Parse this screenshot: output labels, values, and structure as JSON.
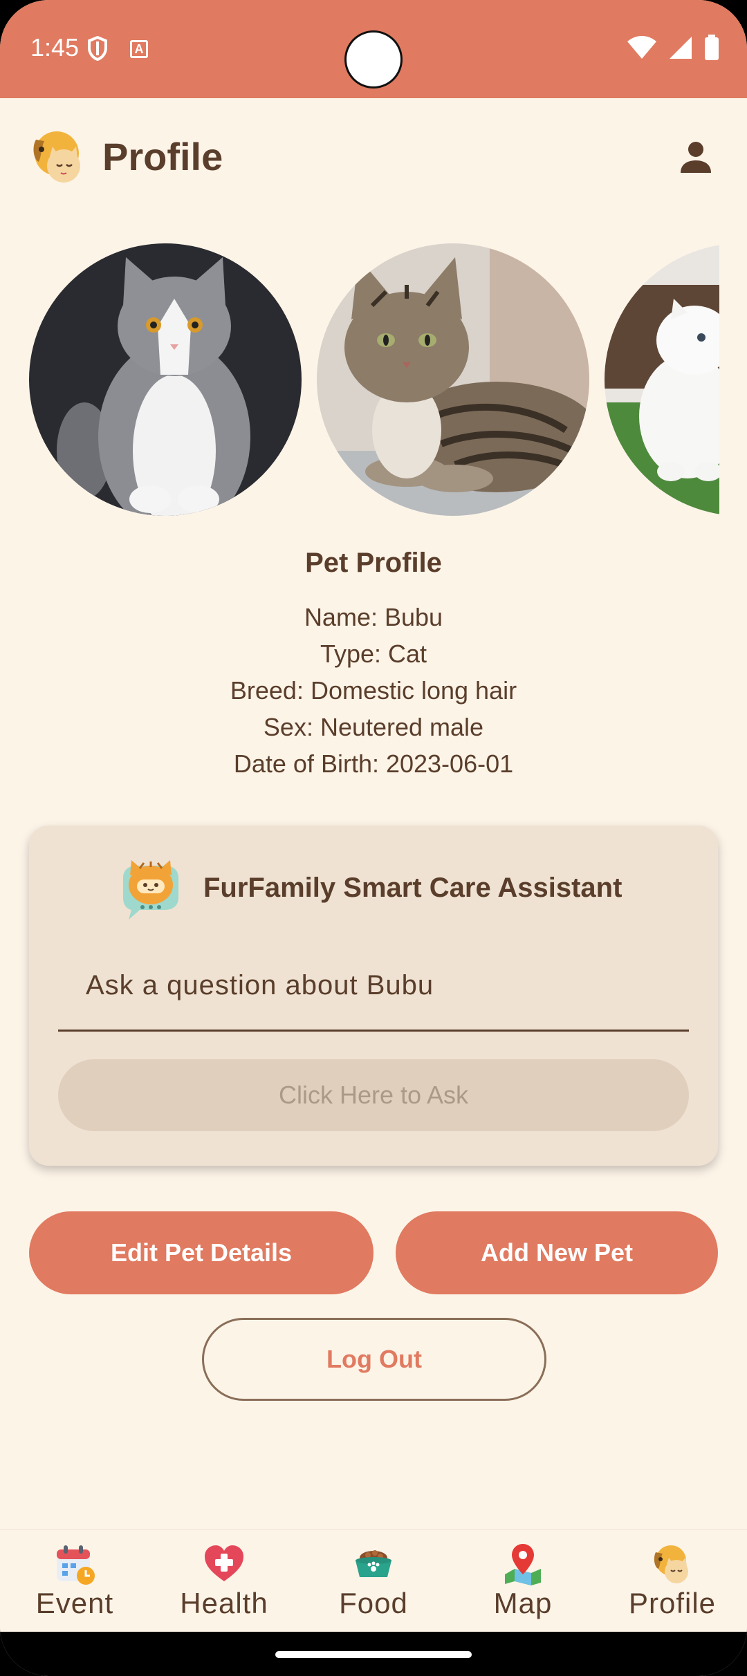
{
  "status_bar": {
    "time": "1:45",
    "a_glyph": "A"
  },
  "app_bar": {
    "title": "Profile",
    "logo_icon": "dog-cat-logo-icon",
    "account_icon": "person-icon"
  },
  "carousel": {
    "photos": [
      "grey-white-cat-photo",
      "tabby-cat-photo",
      "white-persian-cat-photo"
    ]
  },
  "pet_profile": {
    "heading": "Pet Profile",
    "name": "Name: Bubu",
    "type": "Type: Cat",
    "breed": "Breed: Domestic long hair",
    "sex": "Sex: Neutered male",
    "dob": "Date of Birth: 2023-06-01"
  },
  "assistant": {
    "title": "FurFamily Smart Care Assistant",
    "placeholder": "Ask a question about Bubu",
    "ask_button": "Click Here to Ask"
  },
  "actions": {
    "edit": "Edit Pet Details",
    "add": "Add New Pet",
    "logout": "Log Out"
  },
  "nav": [
    {
      "label": "Event",
      "icon": "calendar-icon"
    },
    {
      "label": "Health",
      "icon": "heart-icon"
    },
    {
      "label": "Food",
      "icon": "food-bowl-icon"
    },
    {
      "label": "Map",
      "icon": "map-pin-icon"
    },
    {
      "label": "Profile",
      "icon": "pet-profile-icon"
    }
  ],
  "colors": {
    "accent": "#e07a60",
    "background": "#fdf4e8",
    "text": "#5a3e2b",
    "card": "#efe2d2"
  }
}
